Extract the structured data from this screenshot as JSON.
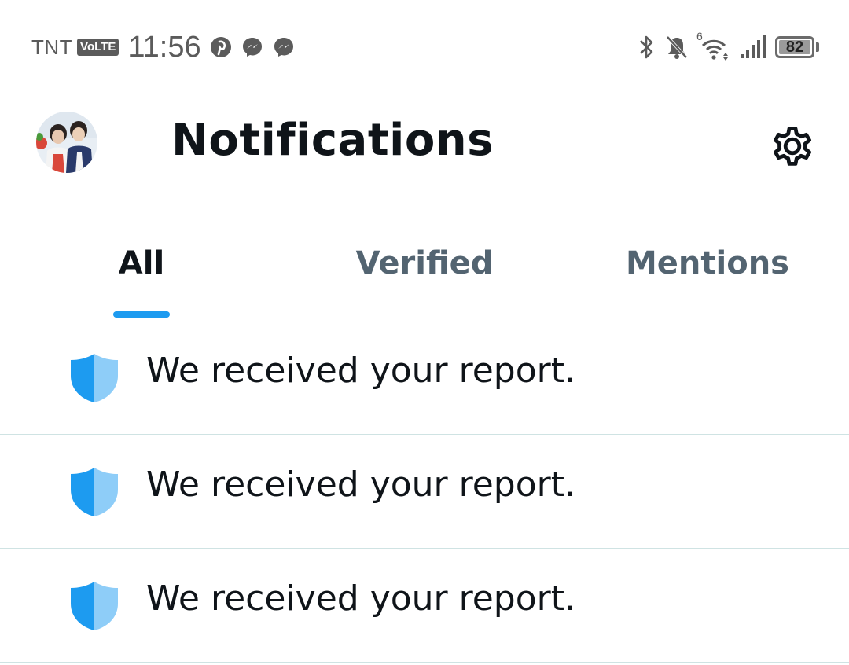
{
  "status_bar": {
    "carrier": "TNT",
    "volte_badge": "VoLTE",
    "time": "11:56",
    "app_icons": [
      "pinterest-icon",
      "messenger-icon",
      "messenger-icon"
    ],
    "network_badge": "6",
    "battery_percent": "82"
  },
  "header": {
    "title": "Notifications",
    "avatar_icon": "avatar",
    "settings_icon": "gear-icon"
  },
  "tabs": [
    {
      "label": "All",
      "active": true
    },
    {
      "label": "Verified",
      "active": false
    },
    {
      "label": "Mentions",
      "active": false
    }
  ],
  "notifications": [
    {
      "icon": "shield-icon",
      "text": "We received your report."
    },
    {
      "icon": "shield-icon",
      "text": "We received your report."
    },
    {
      "icon": "shield-icon",
      "text": "We received your report."
    }
  ],
  "colors": {
    "accent": "#1d9bf0",
    "shield_dark": "#1d9bf0",
    "shield_light": "#8ecdf8",
    "text_primary": "#0f1419",
    "text_secondary": "#536471"
  }
}
